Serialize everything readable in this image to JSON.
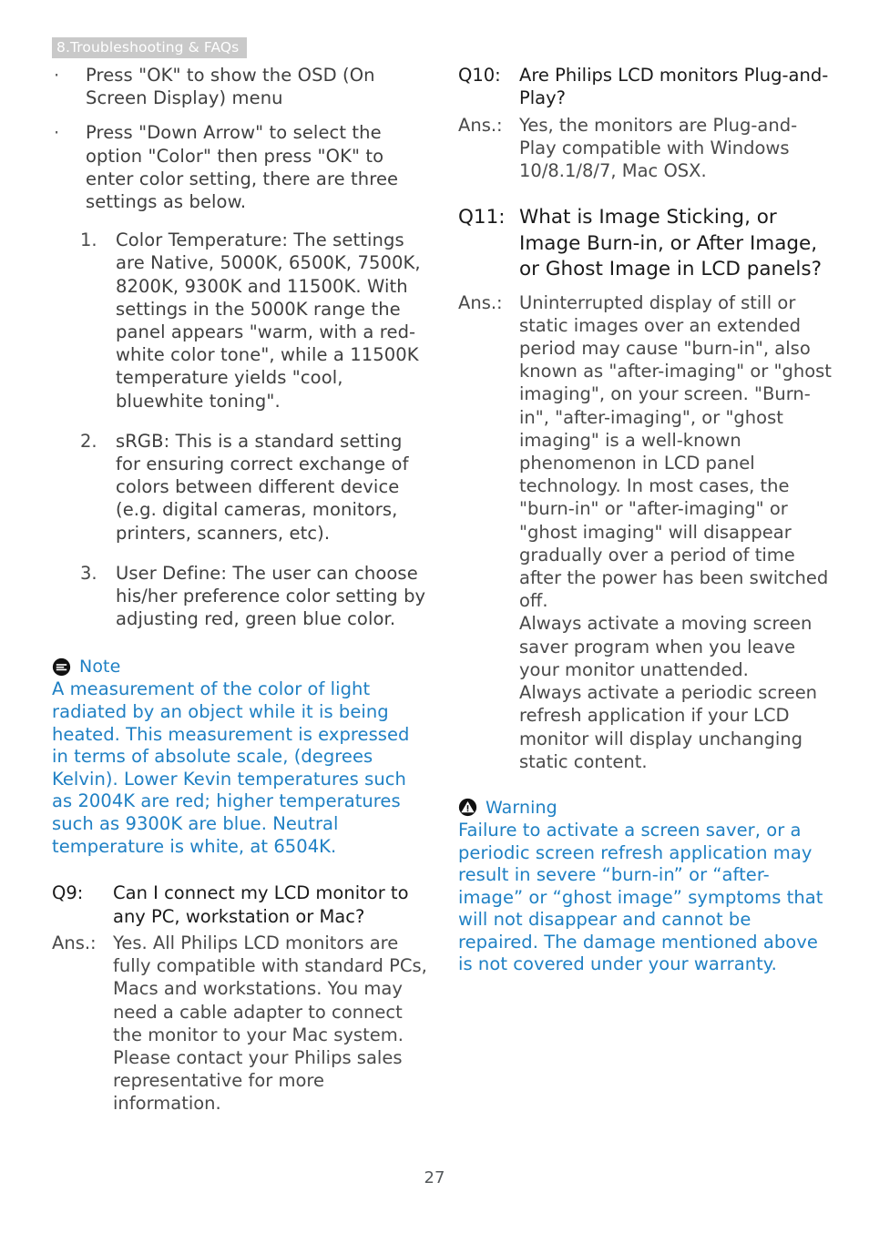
{
  "header": {
    "chapter_band": "8.Troubleshooting & FAQs"
  },
  "colors": {
    "accent_blue": "#1f80c4",
    "band_grey": "#c9c9c9",
    "body_grey": "#3f3f3f",
    "question_black": "#1a1a1a"
  },
  "left_column": {
    "bullets": [
      {
        "marker": "·",
        "text": "Press \"OK\" to show the OSD (On Screen Display) menu"
      },
      {
        "marker": "·",
        "text": "Press \"Down Arrow\" to select the option \"Color\" then press \"OK\" to enter color setting, there are three settings as below."
      }
    ],
    "numbered": [
      {
        "marker": "1.",
        "text": "Color Temperature: The settings are Native, 5000K, 6500K, 7500K, 8200K, 9300K and 11500K. With settings in the 5000K range the panel appears \"warm, with a red-white color tone\", while a 11500K temperature yields \"cool, bluewhite toning\"."
      },
      {
        "marker": "2.",
        "text": "sRGB: This is a standard setting for ensuring correct exchange of colors between different device (e.g. digital cameras, monitors, printers, scanners, etc)."
      },
      {
        "marker": "3.",
        "text": "User Define: The user can choose his/her preference color setting by adjusting red, green blue color."
      }
    ],
    "note": {
      "icon": "note-icon",
      "title": "Note",
      "body": "A measurement of the color of light radiated by an object while it is being heated. This measurement is expressed in terms of absolute scale, (degrees Kelvin). Lower Kevin temperatures such as 2004K are red; higher temperatures such as 9300K are blue. Neutral temperature is white, at 6504K."
    },
    "q9": {
      "question_label": "Q9:",
      "question_text": "Can I connect my LCD monitor to any PC, workstation or Mac?",
      "answer_label": "Ans.:",
      "answer_text": "Yes. All Philips LCD monitors are fully compatible with standard PCs, Macs and workstations. You may need a cable adapter to connect the monitor to your Mac system. Please contact your Philips sales representative for more information."
    }
  },
  "right_column": {
    "q10": {
      "question_label": "Q10:",
      "question_text": "Are Philips LCD monitors Plug-and- Play?",
      "answer_label": "Ans.:",
      "answer_text": "Yes, the monitors are Plug-and-Play compatible with Windows 10/8.1/8/7, Mac OSX."
    },
    "q11": {
      "question_label": "Q11:",
      "question_text": "What is Image Sticking, or Image Burn-in, or After Image, or Ghost Image in LCD panels?",
      "answer_label": "Ans.:",
      "answer_text": "Uninterrupted display of still or static images over an extended period may cause \"burn-in\", also known as \"after-imaging\" or \"ghost imaging\", on your screen. \"Burn-in\", \"after-imaging\", or \"ghost imaging\" is a well-known phenomenon in LCD panel technology. In most cases, the \"burn-in\" or \"after-imaging\" or \"ghost imaging\" will disappear gradually over a period of time after the power has been switched off.\nAlways activate a moving screen saver program when you leave your monitor unattended.\nAlways activate a periodic screen refresh application if your LCD monitor will display unchanging static content."
    },
    "warning": {
      "icon": "warning-icon",
      "title": "Warning",
      "body": "Failure to activate a screen saver, or a periodic screen refresh application may result in severe “burn-in” or “after-image” or “ghost image” symptoms that will not disappear and cannot be repaired. The damage mentioned above is not covered under your warranty."
    }
  },
  "footer": {
    "page_number": "27"
  }
}
